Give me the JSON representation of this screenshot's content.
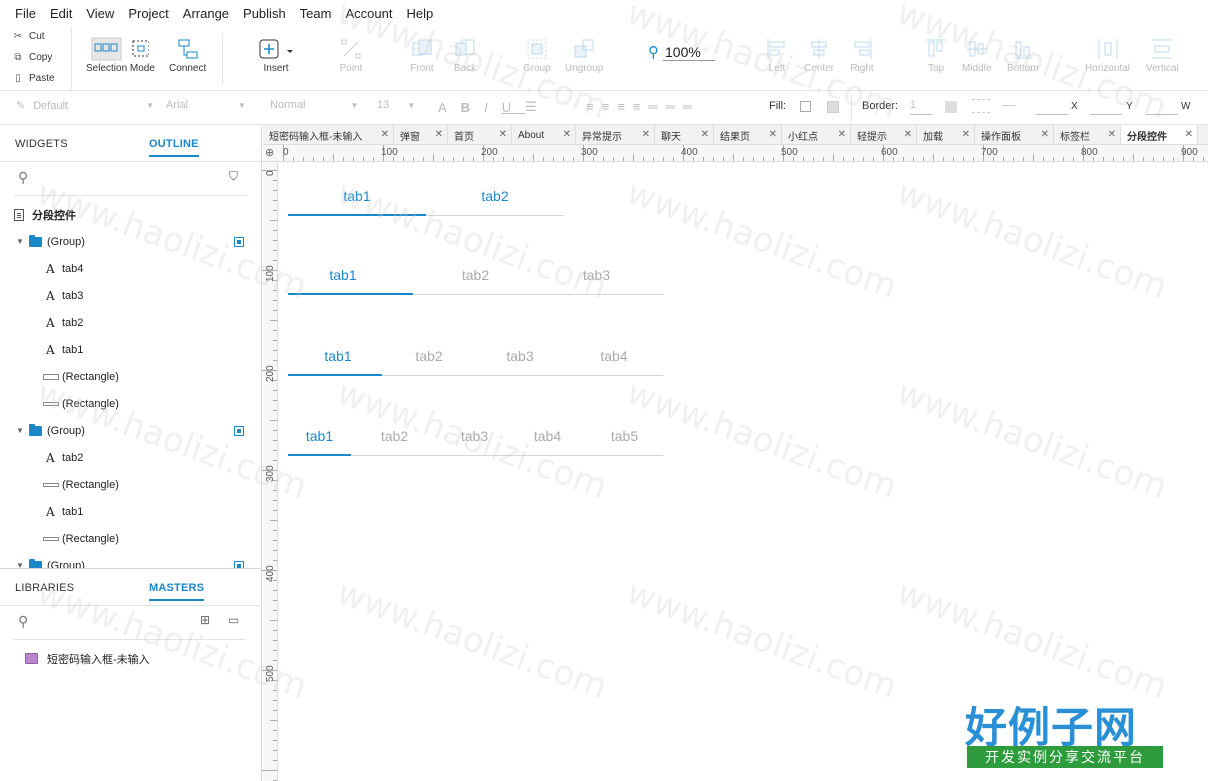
{
  "menu": [
    "File",
    "Edit",
    "View",
    "Project",
    "Arrange",
    "Publish",
    "Team",
    "Account",
    "Help"
  ],
  "clipboard": {
    "cut": "Cut",
    "copy": "Copy",
    "paste": "Paste"
  },
  "toolbar": {
    "selection_mode": "Selection Mode",
    "connect": "Connect",
    "insert": "Insert",
    "point": "Point",
    "front": "Front",
    "back": "Back",
    "group": "Group",
    "ungroup": "Ungroup",
    "zoom": "100%",
    "left": "Left",
    "center": "Center",
    "right": "Right",
    "top": "Top",
    "middle": "Middle",
    "bottom": "Bottom",
    "horizontal": "Horizontal",
    "vertical": "Vertical"
  },
  "stylebar": {
    "style": "Default",
    "font": "Arial",
    "weight": "Normal",
    "size": "13",
    "fill": "Fill:",
    "border": "Border:",
    "border_width": "1",
    "x": "X",
    "y": "Y",
    "w": "W"
  },
  "left_panel": {
    "tabs": [
      "WIDGETS",
      "OUTLINE"
    ],
    "page_name": "分段控件",
    "tree": [
      {
        "label": "(Group)",
        "type": "group"
      },
      {
        "label": "tab4",
        "type": "text"
      },
      {
        "label": "tab3",
        "type": "text"
      },
      {
        "label": "tab2",
        "type": "text"
      },
      {
        "label": "tab1",
        "type": "text"
      },
      {
        "label": "(Rectangle)",
        "type": "rect"
      },
      {
        "label": "(Rectangle)",
        "type": "rect"
      },
      {
        "label": "(Group)",
        "type": "group"
      },
      {
        "label": "tab2",
        "type": "text"
      },
      {
        "label": "(Rectangle)",
        "type": "rect"
      },
      {
        "label": "tab1",
        "type": "text"
      },
      {
        "label": "(Rectangle)",
        "type": "rect"
      },
      {
        "label": "(Group)",
        "type": "group"
      }
    ],
    "lower_tabs": [
      "LIBRARIES",
      "MASTERS"
    ],
    "masters": [
      "短密码输入框-未输入"
    ]
  },
  "doc_tabs": [
    "短密码输入框-未输入",
    "弹窗",
    "首页",
    "About",
    "异常提示",
    "聊天",
    "结果页",
    "小红点",
    "轻提示",
    "加载",
    "操作面板",
    "标签栏",
    "分段控件"
  ],
  "ruler_h": [
    "0",
    "100",
    "200",
    "300",
    "400",
    "500",
    "600",
    "700",
    "800",
    "900"
  ],
  "ruler_v": [
    "0",
    "100",
    "200",
    "300",
    "400",
    "500"
  ],
  "segments": [
    {
      "tabs": [
        "tab1",
        "tab2"
      ],
      "active": 0
    },
    {
      "tabs": [
        "tab1",
        "tab2",
        "tab3"
      ],
      "active": 0
    },
    {
      "tabs": [
        "tab1",
        "tab2",
        "tab3",
        "tab4"
      ],
      "active": 0
    },
    {
      "tabs": [
        "tab1",
        "tab2",
        "tab3",
        "tab4",
        "tab5"
      ],
      "active": 0
    }
  ],
  "watermark": "www.haolizi.com",
  "logo": {
    "title": "好例子网",
    "subtitle": "开发实例分享交流平台"
  },
  "colors": {
    "accent": "#1a88c9",
    "logo_blue": "#2b8fd6",
    "logo_green": "#2e9b3c"
  }
}
